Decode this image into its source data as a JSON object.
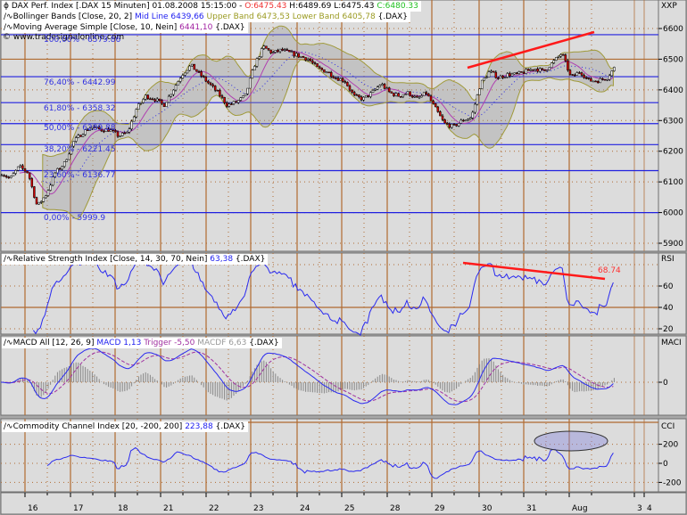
{
  "main": {
    "title_prefix": "DAX Perf. Index [.DAX  15 Minuten] 01.08.2008 15:15:00 - ",
    "open": "O:6475.43",
    "high": "H:6489.69",
    "low": "L:6475.43",
    "close": "C:6480.33",
    "bollinger_label": "Bollinger Bands [Close, 20, 2]",
    "bollinger_mid": "Mid Line 6439,66",
    "bollinger_upper": "Upper Band 6473,53",
    "bollinger_lower": "Lower Band 6405,78",
    "bollinger_suffix": "{.DAX}",
    "sma_label": "Moving Average Simple [Close, 10, Nein]",
    "sma_value": "6441,10",
    "sma_suffix": "{.DAX}",
    "copyright": "© www.tradesignalonline.com",
    "axis_title": "XXP",
    "fib_labels": [
      "100,00% - 6579.86",
      "76,40% - 6442.99",
      "61,80% - 6358.32",
      "50,00% - 6289.88",
      "38,20% - 6221.45",
      "23,60% - 6136.77",
      "0,00% - 5999.9"
    ]
  },
  "rsi": {
    "label": "Relative Strength Index [Close, 14, 30, 70, Nein]",
    "value": "63,38",
    "suffix": "{.DAX}",
    "axis_title": "RSI",
    "annotation": "68.74"
  },
  "macd": {
    "label": "MACD All [12, 26, 9]",
    "macd": "MACD 1,13",
    "trigger": "Trigger -5,50",
    "macdf": "MACDF 6,63",
    "suffix": "{.DAX}",
    "axis_title": "MACI"
  },
  "cci": {
    "label": "Commodity Channel Index [20, -200, 200]",
    "value": "223,88",
    "suffix": "{.DAX}",
    "axis_title": "CCI"
  },
  "x_axis": {
    "labels": [
      "16",
      "17",
      "18",
      "21",
      "22",
      "23",
      "24",
      "25",
      "28",
      "29",
      "30",
      "31",
      "Aug",
      "3",
      "4"
    ]
  },
  "colors": {
    "panel_bg": "#dcdcdc",
    "grid": "#b06a30",
    "fib": "#2020e0",
    "band": "#a09a3a",
    "sma": "#b040b0",
    "indicator": "#2a2af0",
    "trend": "#ff1a1a"
  },
  "chart_data": [
    {
      "type": "candlestick",
      "title": "DAX Perf. Index 15 Minuten",
      "ylim": [
        5870,
        6650
      ],
      "yticks": [
        5900,
        6000,
        6100,
        6200,
        6300,
        6400,
        6500,
        6600
      ],
      "fib_levels": [
        6579.86,
        6442.99,
        6358.32,
        6289.88,
        6221.45,
        6136.77,
        5999.9
      ],
      "close_path_step_sessions": 0.2,
      "close_path_start_session": -0.55,
      "close_path": [
        6130,
        6110,
        6150,
        6130,
        6020,
        6060,
        6130,
        6160,
        6230,
        6260,
        6280,
        6270,
        6270,
        6250,
        6260,
        6340,
        6380,
        6370,
        6350,
        6400,
        6450,
        6480,
        6450,
        6420,
        6390,
        6350,
        6360,
        6380,
        6480,
        6540,
        6520,
        6530,
        6520,
        6510,
        6500,
        6470,
        6460,
        6440,
        6430,
        6380,
        6370,
        6390,
        6420,
        6390,
        6380,
        6390,
        6370,
        6390,
        6340,
        6290,
        6280,
        6300,
        6310,
        6420,
        6460,
        6440,
        6450,
        6450,
        6460,
        6470,
        6460,
        6490,
        6520,
        6440,
        6460,
        6430,
        6430,
        6440,
        6480
      ]
    },
    {
      "type": "line",
      "title": "RSI",
      "ylim": [
        10,
        100
      ],
      "yticks": [
        20,
        40,
        60
      ]
    },
    {
      "type": "line",
      "title": "MACD",
      "yticks": [
        0
      ]
    },
    {
      "type": "line",
      "title": "CCI",
      "ylim": [
        -300,
        450
      ],
      "yticks": [
        -200,
        0,
        200
      ]
    }
  ]
}
